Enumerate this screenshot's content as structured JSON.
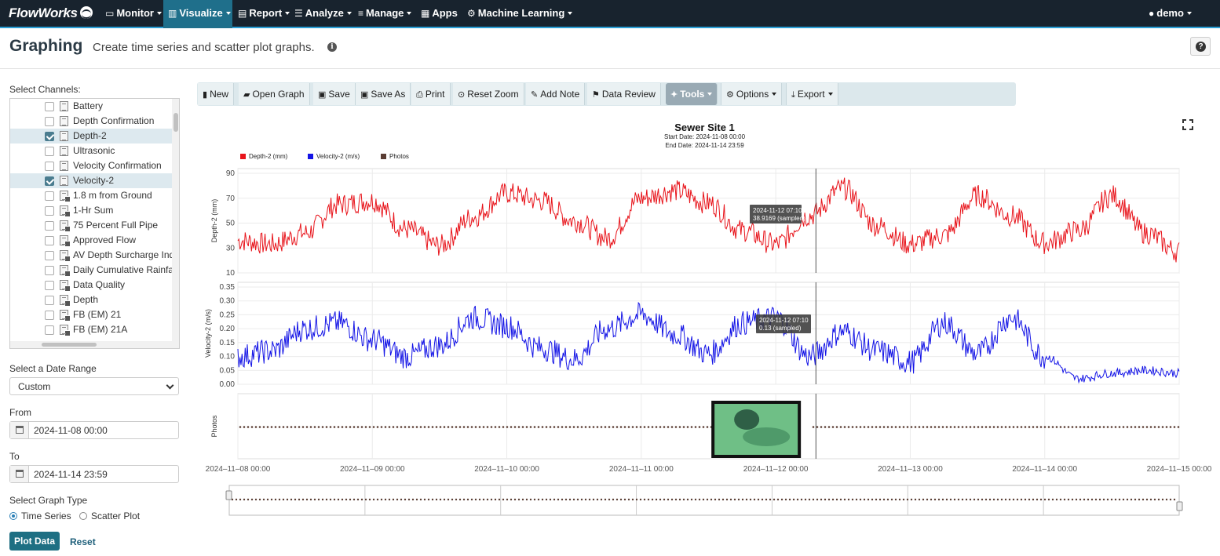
{
  "nav": {
    "brand": "FlowWorks",
    "items": [
      {
        "label": "Monitor",
        "icon": "monitor-icon"
      },
      {
        "label": "Visualize",
        "icon": "bar-chart-icon"
      },
      {
        "label": "Report",
        "icon": "report-icon"
      },
      {
        "label": "Analyze",
        "icon": "list-icon"
      },
      {
        "label": "Manage",
        "icon": "sliders-icon"
      },
      {
        "label": "Apps",
        "icon": "grid-icon"
      },
      {
        "label": "Machine Learning",
        "icon": "gears-icon"
      }
    ],
    "user": "demo"
  },
  "header": {
    "title": "Graphing",
    "subtitle": "Create time series and scatter plot graphs."
  },
  "sidebar": {
    "channels_label": "Select Channels:",
    "channels": [
      {
        "name": "Battery",
        "checked": false,
        "calc": false
      },
      {
        "name": "Depth Confirmation",
        "checked": false,
        "calc": false
      },
      {
        "name": "Depth-2",
        "checked": true,
        "calc": false
      },
      {
        "name": "Ultrasonic",
        "checked": false,
        "calc": false
      },
      {
        "name": "Velocity Confirmation",
        "checked": false,
        "calc": false
      },
      {
        "name": "Velocity-2",
        "checked": true,
        "calc": false
      },
      {
        "name": "1.8 m from Ground",
        "checked": false,
        "calc": true
      },
      {
        "name": "1-Hr Sum",
        "checked": false,
        "calc": true
      },
      {
        "name": "75 Percent Full Pipe",
        "checked": false,
        "calc": true
      },
      {
        "name": "Approved Flow",
        "checked": false,
        "calc": true
      },
      {
        "name": "AV Depth Surcharge Ind",
        "checked": false,
        "calc": true
      },
      {
        "name": "Daily Cumulative Rainfal",
        "checked": false,
        "calc": true
      },
      {
        "name": "Data Quality",
        "checked": false,
        "calc": true
      },
      {
        "name": "Depth",
        "checked": false,
        "calc": true
      },
      {
        "name": "FB (EM) 21",
        "checked": false,
        "calc": true
      },
      {
        "name": "FB (EM) 21A",
        "checked": false,
        "calc": true
      }
    ],
    "date_range_label": "Select a Date Range",
    "date_range_value": "Custom",
    "from_label": "From",
    "from_value": "2024-11-08 00:00",
    "to_label": "To",
    "to_value": "2024-11-14 23:59",
    "graph_type_label": "Select Graph Type",
    "graph_types": [
      "Time Series",
      "Scatter Plot"
    ],
    "graph_type_selected": "Time Series",
    "plot_button": "Plot Data",
    "reset_button": "Reset"
  },
  "toolbar": {
    "buttons": [
      {
        "label": "New",
        "icon": "file-icon"
      },
      {
        "label": "Open Graph",
        "icon": "folder-open-icon"
      },
      {
        "label": "Save",
        "icon": "floppy-icon"
      },
      {
        "label": "Save As",
        "icon": "floppy-icon"
      },
      {
        "label": "Print",
        "icon": "print-icon"
      },
      {
        "label": "Reset Zoom",
        "icon": "zoom-icon"
      },
      {
        "label": "Add Note",
        "icon": "pencil-icon"
      },
      {
        "label": "Data Review",
        "icon": "flag-icon"
      },
      {
        "label": "Tools",
        "icon": "wrench-icon"
      },
      {
        "label": "Options",
        "icon": "gear-icon"
      },
      {
        "label": "Export",
        "icon": "download-icon"
      }
    ]
  },
  "chart_data": {
    "type": "line",
    "title": "Sewer Site 1",
    "start_date": "Start Date: 2024-11-08 00:00",
    "end_date": "End Date: 2024-11-14 23:59",
    "legend_placement": "top-left",
    "legend": [
      {
        "name": "Depth-2 (mm)",
        "color": "#e8141b"
      },
      {
        "name": "Velocity-2 (m/s)",
        "color": "#1414e6"
      },
      {
        "name": "Photos",
        "color": "#5a3d33"
      }
    ],
    "x_range": [
      "2024-11-08 00:00",
      "2024-11-15 00:00"
    ],
    "x_ticks": [
      "2024–11–08 00:00",
      "2024–11–09 00:00",
      "2024–11–10 00:00",
      "2024–11–11 00:00",
      "2024–11–12 00:00",
      "2024–11–13 00:00",
      "2024–11–14 00:00",
      "2024–11–15 00:00"
    ],
    "grid": true,
    "cursor_time": "2024-11-12 07:10",
    "panels": [
      {
        "ylabel": "Depth-2 (mm)",
        "color": "#e8141b",
        "ylim": [
          10,
          90
        ],
        "yticks": [
          10,
          30,
          50,
          70,
          90
        ],
        "tooltip": [
          "2024-11-12 07:10",
          "38.9169  (sampled)"
        ],
        "series": {
          "name": "Depth-2 (mm)",
          "x": [
            "2024-11-08 00:00",
            "2024-11-08 06:00",
            "2024-11-08 12:00",
            "2024-11-08 18:00",
            "2024-11-09 00:00",
            "2024-11-09 06:00",
            "2024-11-09 12:00",
            "2024-11-09 18:00",
            "2024-11-10 00:00",
            "2024-11-10 06:00",
            "2024-11-10 12:00",
            "2024-11-10 18:00",
            "2024-11-11 00:00",
            "2024-11-11 06:00",
            "2024-11-11 12:00",
            "2024-11-11 18:00",
            "2024-11-12 00:00",
            "2024-11-12 06:00",
            "2024-11-12 12:00",
            "2024-11-12 18:00",
            "2024-11-13 00:00",
            "2024-11-13 06:00",
            "2024-11-13 12:00",
            "2024-11-13 18:00",
            "2024-11-14 00:00",
            "2024-11-14 06:00",
            "2024-11-14 12:00",
            "2024-11-14 18:00",
            "2024-11-15 00:00"
          ],
          "values": [
            36,
            33,
            42,
            65,
            68,
            45,
            32,
            55,
            74,
            68,
            52,
            38,
            70,
            76,
            66,
            44,
            33,
            56,
            78,
            48,
            33,
            40,
            72,
            56,
            34,
            44,
            72,
            42,
            27
          ]
        }
      },
      {
        "ylabel": "Velocity-2 (m/s)",
        "color": "#1414e6",
        "ylim": [
          0,
          0.35
        ],
        "yticks": [
          0.0,
          0.05,
          0.1,
          0.15,
          0.2,
          0.25,
          0.3,
          0.35
        ],
        "tooltip": [
          "2024-11-12 07:10",
          "0.13  (sampled)"
        ],
        "series": {
          "name": "Velocity-2 (m/s)",
          "x": [
            "2024-11-08 00:00",
            "2024-11-08 06:00",
            "2024-11-08 12:00",
            "2024-11-08 18:00",
            "2024-11-09 00:00",
            "2024-11-09 06:00",
            "2024-11-09 12:00",
            "2024-11-09 18:00",
            "2024-11-10 00:00",
            "2024-11-10 06:00",
            "2024-11-10 12:00",
            "2024-11-10 18:00",
            "2024-11-11 00:00",
            "2024-11-11 06:00",
            "2024-11-11 12:00",
            "2024-11-11 18:00",
            "2024-11-12 00:00",
            "2024-11-12 06:00",
            "2024-11-12 12:00",
            "2024-11-12 18:00",
            "2024-11-13 00:00",
            "2024-11-13 06:00",
            "2024-11-13 12:00",
            "2024-11-13 18:00",
            "2024-11-14 00:00",
            "2024-11-14 06:00",
            "2024-11-14 12:00",
            "2024-11-14 18:00",
            "2024-11-15 00:00"
          ],
          "values": [
            0.1,
            0.12,
            0.2,
            0.22,
            0.16,
            0.1,
            0.14,
            0.24,
            0.21,
            0.13,
            0.09,
            0.2,
            0.25,
            0.18,
            0.11,
            0.22,
            0.24,
            0.1,
            0.19,
            0.12,
            0.08,
            0.22,
            0.11,
            0.24,
            0.1,
            0.02,
            0.04,
            0.05,
            0.04
          ]
        }
      },
      {
        "ylabel": "Photos",
        "color": "#5a3d33",
        "photo_time": "2024-11-12 00:00"
      }
    ]
  }
}
